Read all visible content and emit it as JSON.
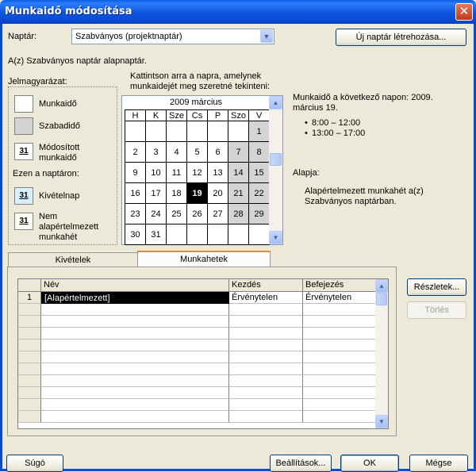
{
  "window": {
    "title": "Munkaidő módosítása",
    "close_label": "✕"
  },
  "calendar_select": {
    "label": "Naptár:",
    "value": "Szabványos (projektnaptár)"
  },
  "new_calendar_button": "Új naptár létrehozása...",
  "base_calendar_text": "A(z) Szabványos naptár alapnaptár.",
  "legend": {
    "title": "Jelmagyarázat:",
    "items": [
      {
        "label": "Munkaidő",
        "swatch": ""
      },
      {
        "label": "Szabadidő",
        "swatch": ""
      },
      {
        "label_lines": [
          "Módosított",
          "munkaidő"
        ],
        "swatch": "31"
      }
    ],
    "on_calendar_title": "Ezen a naptáron:",
    "calendar_items": [
      {
        "label": "Kivételnap",
        "swatch": "31"
      },
      {
        "label_lines": [
          "Nem",
          "alapértelmezett",
          "munkahét"
        ],
        "swatch": "31"
      }
    ]
  },
  "click_hint": {
    "lines": [
      "Kattintson arra a napra, amelynek",
      "munkaidejét meg szeretné tekinteni:"
    ]
  },
  "mini_calendar": {
    "month": "2009 március",
    "weekdays": [
      "H",
      "K",
      "Sze",
      "Cs",
      "P",
      "Szo",
      "V"
    ],
    "weeks": [
      [
        "",
        "",
        "",
        "",
        "",
        "",
        "1"
      ],
      [
        "2",
        "3",
        "4",
        "5",
        "6",
        "7",
        "8"
      ],
      [
        "9",
        "10",
        "11",
        "12",
        "13",
        "14",
        "15"
      ],
      [
        "16",
        "17",
        "18",
        "19",
        "20",
        "21",
        "22"
      ],
      [
        "23",
        "24",
        "25",
        "26",
        "27",
        "28",
        "29"
      ],
      [
        "30",
        "31",
        "",
        "",
        "",
        "",
        ""
      ]
    ],
    "selected_day": "19",
    "colors": {
      "weekend": "#d4d4d4",
      "selected": "#000000"
    }
  },
  "work_info": {
    "lines": [
      "Munkaidő a következő napon: 2009.",
      "március 19."
    ],
    "times": [
      "8:00 – 12:00",
      "13:00 – 17:00"
    ],
    "basis_title": "Alapja:",
    "basis_lines": [
      "Alapértelmezett munkahét a(z)",
      "Szabványos naptárban."
    ]
  },
  "tabs": {
    "exceptions": "Kivételek",
    "work_weeks": "Munkahetek"
  },
  "workweek_table": {
    "columns": [
      "Név",
      "Kezdés",
      "Befejezés"
    ],
    "rows": [
      {
        "num": "1",
        "name": "[Alapértelmezett]",
        "start": "Érvénytelen",
        "finish": "Érvénytelen"
      }
    ]
  },
  "side_buttons": {
    "details": "Részletek...",
    "delete": "Törlés"
  },
  "footer": {
    "help": "Súgó",
    "options": "Beállítások...",
    "ok": "OK",
    "cancel": "Mégse"
  }
}
